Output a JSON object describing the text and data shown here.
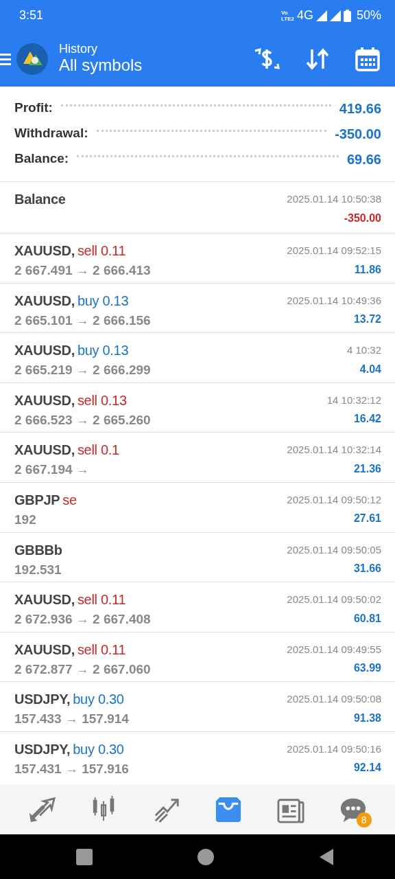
{
  "status_bar": {
    "time": "3:51",
    "volte_top": "Vo",
    "volte_bottom": "LTE2",
    "network": "4G",
    "battery": "50%"
  },
  "header": {
    "subtitle": "History",
    "title": "All symbols"
  },
  "summary": [
    {
      "label": "Profit:",
      "value": "419.66"
    },
    {
      "label": "Withdrawal:",
      "value": "-350.00"
    },
    {
      "label": "Balance:",
      "value": "69.66"
    }
  ],
  "rows": [
    {
      "kind": "balance",
      "title": "Balance",
      "time": "2025.01.14 10:50:38",
      "amount": "-350.00",
      "loss": true
    },
    {
      "kind": "trade",
      "symbol": "XAUUSD,",
      "side": "sell 0.11",
      "buy": false,
      "prices": "2 667.491 → 2 666.413",
      "time": "2025.01.14 09:52:15",
      "amount": "11.86",
      "loss": false
    },
    {
      "kind": "trade",
      "symbol": "XAUUSD,",
      "side": "buy 0.13",
      "buy": true,
      "prices": "2 665.101 → 2 666.156",
      "time": "2025.01.14 10:49:36",
      "amount": "13.72",
      "loss": false
    },
    {
      "kind": "trade",
      "symbol": "XAUUSD,",
      "side": "buy 0.13",
      "buy": true,
      "prices": "2 665.219 → 2 666.299",
      "time": "4 10:32",
      "amount": "4.04",
      "loss": false
    },
    {
      "kind": "trade",
      "symbol": "XAUUSD,",
      "side": "sell 0.13",
      "buy": false,
      "prices": "2 666.523 → 2 665.260",
      "time": "14 10:32:12",
      "amount": "16.42",
      "loss": false
    },
    {
      "kind": "trade",
      "symbol": "XAUUSD,",
      "side": "sell 0.1",
      "buy": false,
      "prices": "2 667.194 →",
      "time": "2025.01.14 10:32:14",
      "amount": "21.36",
      "loss": false
    },
    {
      "kind": "trade",
      "symbol": "GBPJP",
      "side": "se",
      "buy": false,
      "prices": "192",
      "time": "2025.01.14 09:50:12",
      "amount": "27.61",
      "loss": false
    },
    {
      "kind": "trade",
      "symbol": "GBBBb",
      "prices": "192.531",
      "time": "2025.01.14 09:50:05",
      "amount": "31.66",
      "loss": false
    },
    {
      "kind": "trade",
      "symbol": "XAUUSD,",
      "side": "sell 0.11",
      "buy": false,
      "prices": "2 672.936 → 2 667.408",
      "time": "2025.01.14 09:50:02",
      "amount": "60.81",
      "loss": false
    },
    {
      "kind": "trade",
      "symbol": "XAUUSD,",
      "side": "sell 0.11",
      "buy": false,
      "prices": "2 672.877 → 2 667.060",
      "time": "2025.01.14 09:49:55",
      "amount": "63.99",
      "loss": false
    },
    {
      "kind": "trade",
      "symbol": "USDJPY,",
      "side": "buy 0.30",
      "buy": true,
      "prices": "157.433 → 157.914",
      "time": "2025.01.14 09:50:08",
      "amount": "91.38",
      "loss": false
    },
    {
      "kind": "trade",
      "symbol": "USDJPY,",
      "side": "buy 0.30",
      "buy": true,
      "prices": "157.431 → 157.916",
      "time": "2025.01.14 09:50:16",
      "amount": "92.14",
      "loss": false
    }
  ],
  "bottom_nav": [
    {
      "selected": false
    },
    {
      "selected": false
    },
    {
      "selected": false
    },
    {
      "selected": true
    },
    {
      "selected": false
    },
    {
      "selected": false,
      "badge": "8"
    }
  ]
}
